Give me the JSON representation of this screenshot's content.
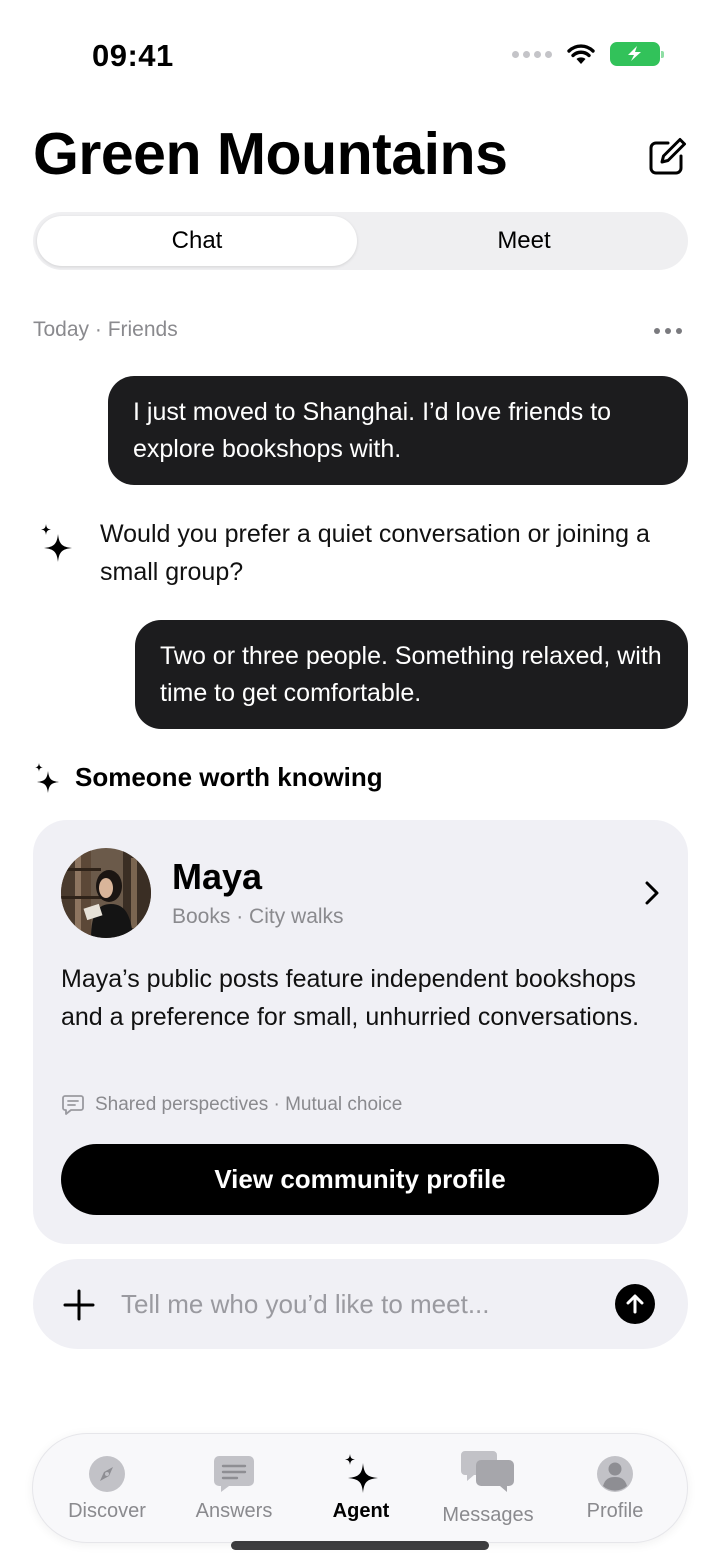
{
  "status_bar": {
    "time": "09:41"
  },
  "header": {
    "title": "Green Mountains"
  },
  "segments": {
    "chat": "Chat",
    "meet": "Meet"
  },
  "conversation": {
    "meta": "Today · Friends",
    "messages": [
      {
        "role": "user",
        "text": "I just moved to Shanghai. I’d love friends to explore bookshops with."
      },
      {
        "role": "agent",
        "text": "Would you prefer a quiet conversation or joining a small group?"
      },
      {
        "role": "user",
        "text": "Two or three people. Something relaxed, with time to get comfortable."
      }
    ]
  },
  "suggestion": {
    "section_title": "Someone worth knowing",
    "name": "Maya",
    "tags": "Books · City walks",
    "description": "Maya’s public posts feature independent bookshops and a preference for small, unhurried conversations.",
    "meta": "Shared perspectives · Mutual choice",
    "button_label": "View community profile"
  },
  "composer": {
    "placeholder": "Tell me who you’d like to meet..."
  },
  "tab_bar": {
    "items": [
      {
        "label": "Discover",
        "icon": "compass-icon"
      },
      {
        "label": "Answers",
        "icon": "message-lines-icon"
      },
      {
        "label": "Agent",
        "icon": "sparkle-icon",
        "active": true
      },
      {
        "label": "Messages",
        "icon": "chat-bubbles-icon"
      },
      {
        "label": "Profile",
        "icon": "person-icon"
      }
    ]
  },
  "colors": {
    "battery": "#32c25a",
    "bubble": "#1c1c1e",
    "card": "#f0f0f5"
  }
}
